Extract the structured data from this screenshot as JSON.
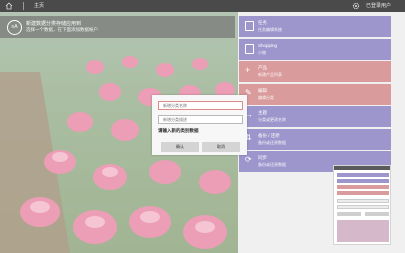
{
  "topbar": {
    "title": "主页",
    "settings_label": "已登录用户"
  },
  "banner": {
    "logo_text": "≡A",
    "line1": "新建数据分类存储应用到",
    "line2": "选择一个数据，在下面添加数据帐户"
  },
  "tiles": [
    {
      "title": "任务",
      "subtitle": "任务编辑系统",
      "color": "#9c96cc"
    },
    {
      "title": "Shopping",
      "subtitle": "小物",
      "color": "#9c96cc"
    },
    {
      "title": "产品",
      "subtitle": "新建产品列表",
      "color": "#d99b9b"
    },
    {
      "title": "编辑",
      "subtitle": "编辑分类",
      "color": "#d99b9b"
    },
    {
      "title": "主题",
      "subtitle": "分类或更改名称",
      "color": "#9c96cc"
    },
    {
      "title": "备份 / 还原",
      "subtitle": "备份或还原数据",
      "color": "#9c96cc"
    },
    {
      "title": "同步",
      "subtitle": "备份或还原数据",
      "color": "#9c96cc"
    }
  ],
  "dialog": {
    "name_placeholder": "新增分类名称",
    "desc_placeholder": "新增分类描述",
    "prompt": "请输入新的类别数据",
    "ok_label": "确认",
    "cancel_label": "取消"
  }
}
